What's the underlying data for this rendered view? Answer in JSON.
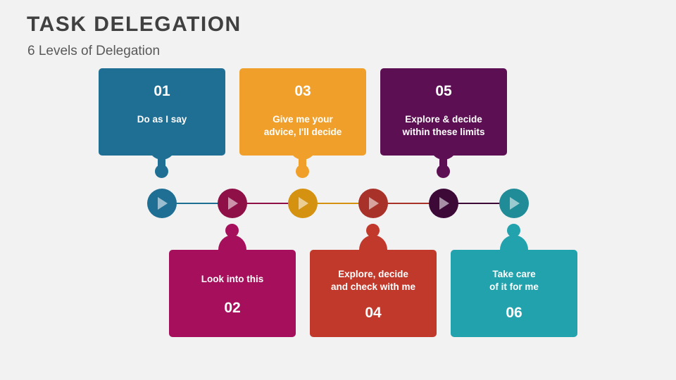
{
  "header": {
    "title": "TASK DELEGATION",
    "subtitle": "6 Levels of Delegation"
  },
  "colors": {
    "background": "#f2f2f2",
    "title": "#404040",
    "subtitle": "#595959",
    "level1": "#1f6f94",
    "level2": "#a50f5b",
    "level3": "#f0a02a",
    "level4": "#c1392b",
    "level5": "#5c0f52",
    "level6": "#22a2ad",
    "node1": "#1f6f94",
    "node2": "#8e1046",
    "node3": "#d49210",
    "node4": "#a8322a",
    "node5": "#3d0a38",
    "node6": "#1f8c98"
  },
  "diagram": {
    "type": "process-timeline",
    "levels": [
      {
        "number": "01",
        "text": "Do as I say",
        "position": "top",
        "color": "#1f6f94",
        "node_color": "#1f6f94"
      },
      {
        "number": "02",
        "text": "Look into this",
        "position": "bottom",
        "color": "#a50f5b",
        "node_color": "#8e1046"
      },
      {
        "number": "03",
        "text": "Give me your\nadvice, I'll decide",
        "line1": "Give me your",
        "line2": "advice, I'll decide",
        "position": "top",
        "color": "#f0a02a",
        "node_color": "#d49210"
      },
      {
        "number": "04",
        "text": "Explore, decide\nand check with me",
        "line1": "Explore, decide",
        "line2": "and check with me",
        "position": "bottom",
        "color": "#c1392b",
        "node_color": "#a8322a"
      },
      {
        "number": "05",
        "text": "Explore & decide\nwithin these limits",
        "line1": "Explore & decide",
        "line2": "within these limits",
        "position": "top",
        "color": "#5c0f52",
        "node_color": "#3d0a38"
      },
      {
        "number": "06",
        "text": "Take care\nof it for me",
        "line1": "Take care",
        "line2": "of it for me",
        "position": "bottom",
        "color": "#22a2ad",
        "node_color": "#1f8c98"
      }
    ]
  }
}
